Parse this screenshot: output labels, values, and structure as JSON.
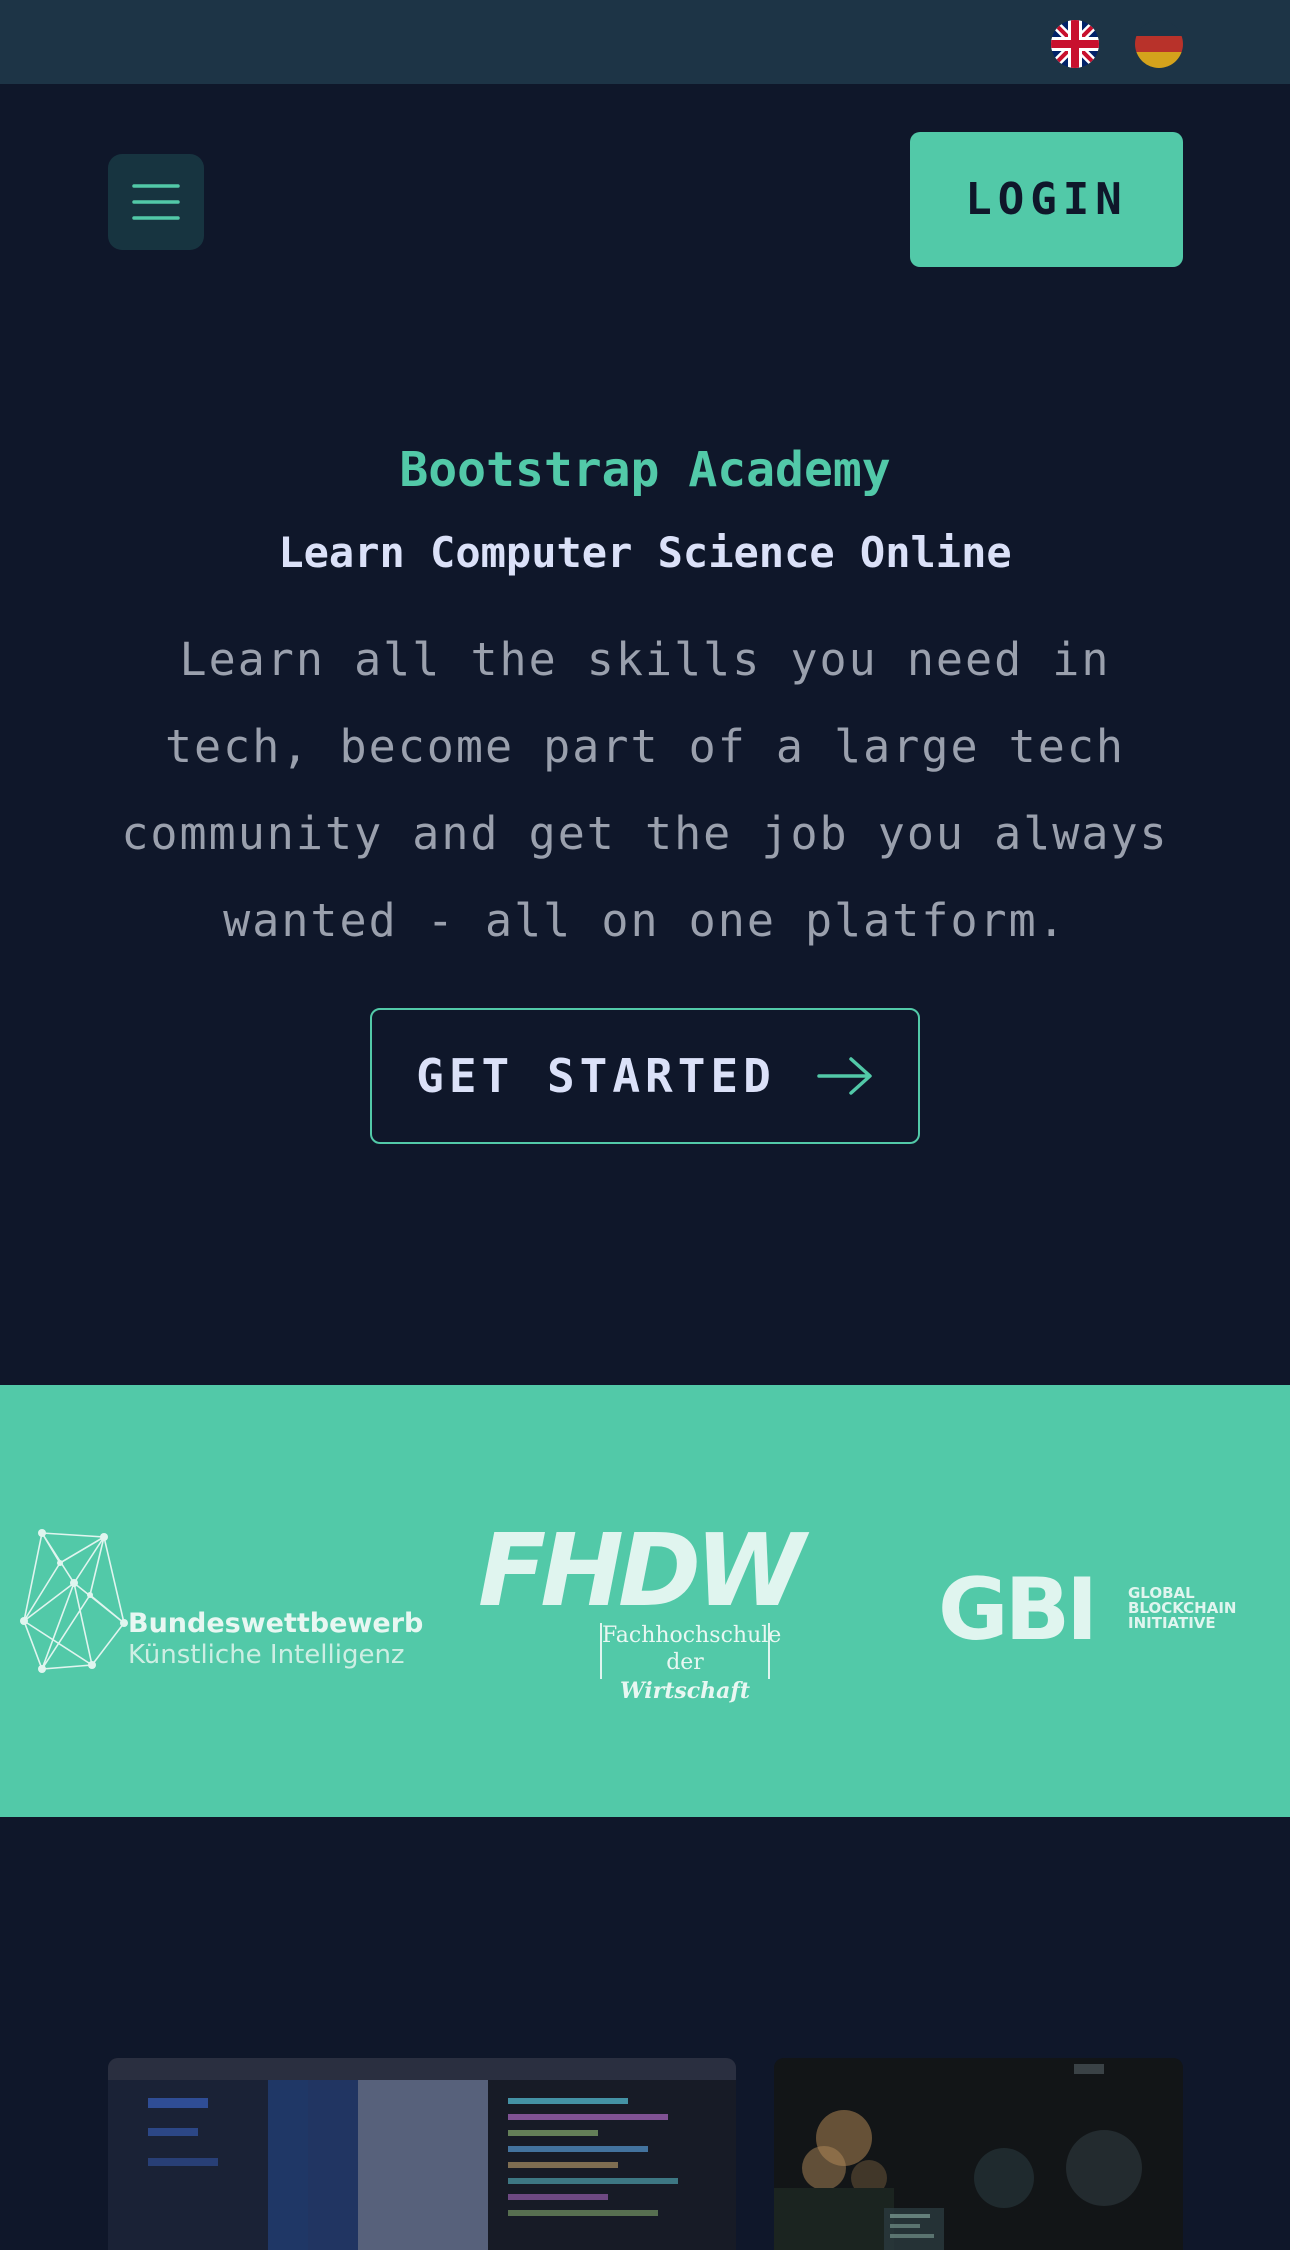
{
  "language_bar": {
    "languages": [
      {
        "code": "en",
        "icon": "uk-flag-icon"
      },
      {
        "code": "de",
        "icon": "germany-flag-icon"
      }
    ]
  },
  "nav": {
    "menu_icon": "hamburger-menu-icon",
    "login_label": "LOGIN"
  },
  "hero": {
    "brand": "Bootstrap Academy",
    "subtitle": "Learn Computer Science Online",
    "description": "Learn all the skills you need in tech, become part of a large tech community and get the job you always wanted - all on one platform.",
    "cta_label": "GET STARTED",
    "cta_icon": "arrow-right-icon"
  },
  "partners": {
    "bwki": {
      "line1": "Bundeswettbewerb",
      "line2": "Künstliche Intelligenz"
    },
    "fhdw": {
      "mark": "FHDW",
      "line1": "Fachhochschule",
      "line2_prefix": "der",
      "line2_emph": "Wirtschaft"
    },
    "gbi": {
      "mark": "GBI",
      "lines": [
        "GLOBAL",
        "BLOCKCHAIN",
        "INITIATIVE"
      ]
    }
  },
  "colors": {
    "background": "#0f172a",
    "accent": "#52c9a8",
    "top_bar": "#1d3446",
    "heading_light": "#dbe1f8",
    "body_text": "#9aa0ad"
  }
}
